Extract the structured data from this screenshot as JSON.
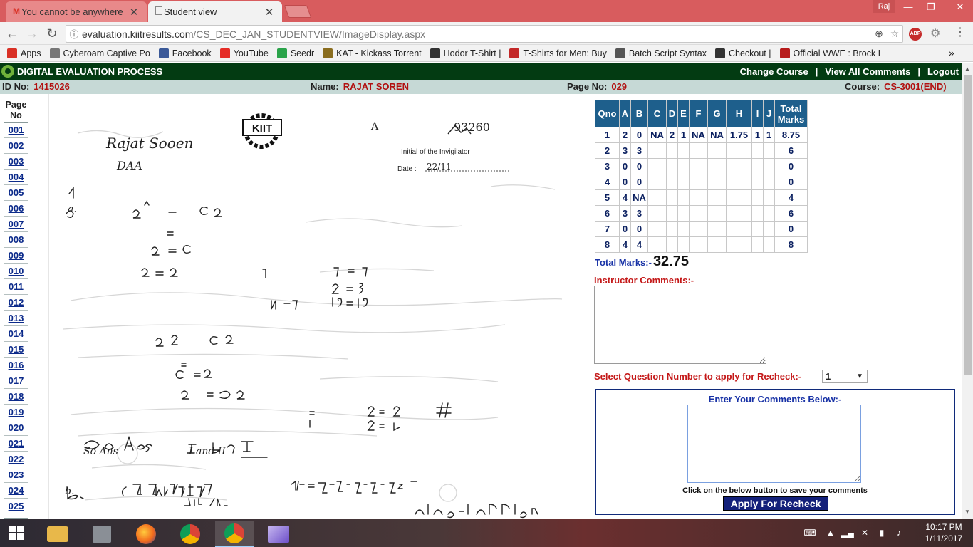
{
  "browser": {
    "tabs": [
      {
        "title": "You cannot be anywhere",
        "favicon": "gmail-icon"
      },
      {
        "title": "Student view",
        "favicon": "page-icon"
      }
    ],
    "user": "Raj",
    "url_host": "evaluation.kiitresults.com",
    "url_path": "/CS_DEC_JAN_STUDENTVIEW/ImageDisplay.aspx",
    "abp_count": "1",
    "bookmarks": [
      {
        "label": "Apps",
        "icon": "apps-grid-icon",
        "color": "#d93025"
      },
      {
        "label": "Cyberoam Captive Po",
        "icon": "page-icon",
        "color": "#777777"
      },
      {
        "label": "Facebook",
        "icon": "facebook-icon",
        "color": "#3b5998"
      },
      {
        "label": "YouTube",
        "icon": "youtube-icon",
        "color": "#e52d27"
      },
      {
        "label": "Seedr",
        "icon": "seedr-icon",
        "color": "#2aa34a"
      },
      {
        "label": "KAT - Kickass Torrent",
        "icon": "kat-icon",
        "color": "#8a6d1f"
      },
      {
        "label": "Hodor T-Shirt |",
        "icon": "dollar-icon",
        "color": "#333333"
      },
      {
        "label": "T-Shirts for Men: Buy",
        "icon": "tshirt-icon",
        "color": "#c32929"
      },
      {
        "label": "Batch Script Syntax",
        "icon": "diamond-icon",
        "color": "#555555"
      },
      {
        "label": "Checkout |",
        "icon": "dollar-icon",
        "color": "#333333"
      },
      {
        "label": "Official WWE : Brock L",
        "icon": "wwe-icon",
        "color": "#b71c1c"
      }
    ]
  },
  "header": {
    "title": "DIGITAL EVALUATION PROCESS",
    "links": [
      "Change Course",
      "View All Comments",
      "Logout"
    ],
    "separator": "|"
  },
  "info": {
    "id_label": "ID No:",
    "id_value": "1415026",
    "name_label": "Name:",
    "name_value": "RAJAT SOREN",
    "page_label": "Page No:",
    "page_value": "029",
    "course_label": "Course:",
    "course_value": "CS-3001(END)"
  },
  "pages": {
    "head_line1": "Page",
    "head_line2": "No",
    "items": [
      "001",
      "002",
      "003",
      "004",
      "005",
      "006",
      "007",
      "008",
      "009",
      "010",
      "011",
      "012",
      "013",
      "014",
      "015",
      "016",
      "017",
      "018",
      "019",
      "020",
      "021",
      "022",
      "023",
      "024",
      "025"
    ]
  },
  "sheet": {
    "name": "Rajat Sooen",
    "subject": "DAA",
    "logo": "KIIT",
    "set": "A",
    "roll": "93260",
    "invigilator": "Initial of the Invigilator",
    "date_label": "Date :",
    "date_value": "22/11"
  },
  "marks": {
    "headers": [
      "Qno",
      "A",
      "B",
      "C",
      "D",
      "E",
      "F",
      "G",
      "H",
      "I",
      "J",
      "Total Marks"
    ],
    "rows": [
      [
        "1",
        "2",
        "0",
        "NA",
        "2",
        "1",
        "NA",
        "NA",
        "1.75",
        "1",
        "1",
        "8.75"
      ],
      [
        "2",
        "3",
        "3",
        "",
        "",
        "",
        "",
        "",
        "",
        "",
        "",
        "6"
      ],
      [
        "3",
        "0",
        "0",
        "",
        "",
        "",
        "",
        "",
        "",
        "",
        "",
        "0"
      ],
      [
        "4",
        "0",
        "0",
        "",
        "",
        "",
        "",
        "",
        "",
        "",
        "",
        "0"
      ],
      [
        "5",
        "4",
        "NA",
        "",
        "",
        "",
        "",
        "",
        "",
        "",
        "",
        "4"
      ],
      [
        "6",
        "3",
        "3",
        "",
        "",
        "",
        "",
        "",
        "",
        "",
        "",
        "6"
      ],
      [
        "7",
        "0",
        "0",
        "",
        "",
        "",
        "",
        "",
        "",
        "",
        "",
        "0"
      ],
      [
        "8",
        "4",
        "4",
        "",
        "",
        "",
        "",
        "",
        "",
        "",
        "",
        "8"
      ]
    ],
    "total_label": "Total Marks:-",
    "total_value": "32.75"
  },
  "comments": {
    "instructor_label": "Instructor Comments:-",
    "recheck_label": "Select Question Number to apply for Recheck:-",
    "selected_question": "1",
    "panel_title": "Enter Your Comments Below:-",
    "save_hint": "Click on the below button to save your comments",
    "apply_button": "Apply For Recheck"
  },
  "taskbar": {
    "time": "10:17 PM",
    "date": "1/11/2017"
  }
}
